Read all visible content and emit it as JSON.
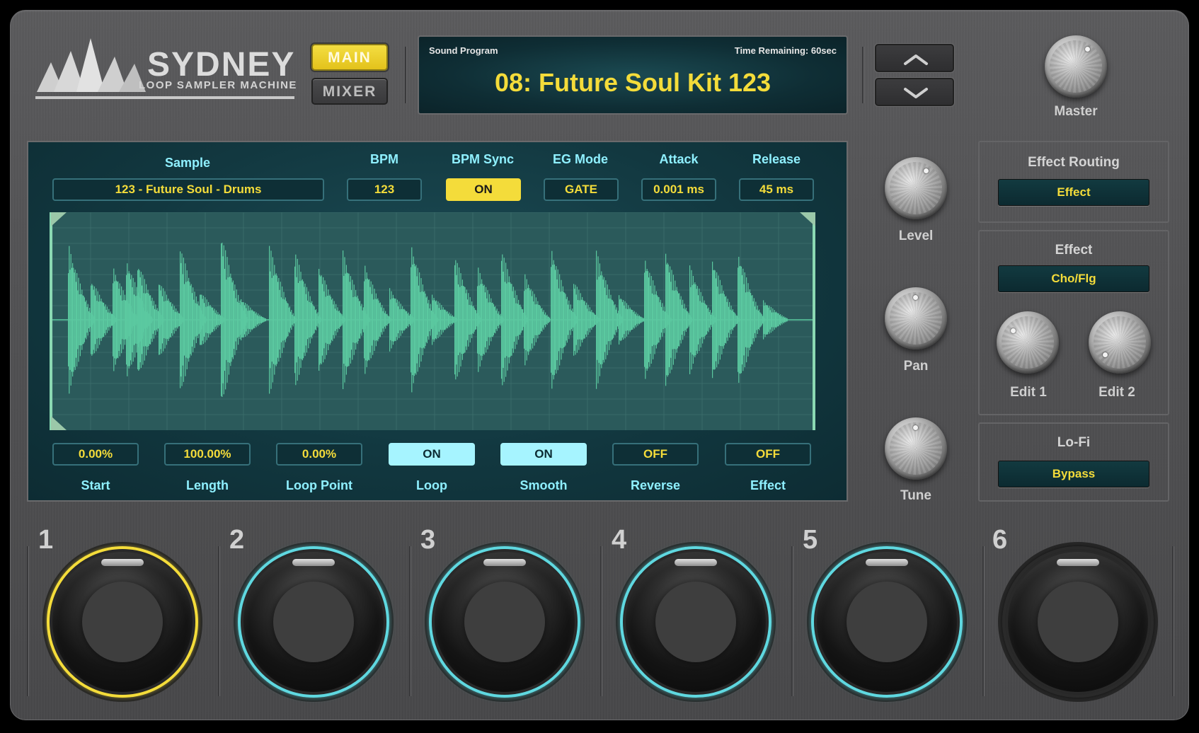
{
  "logo": {
    "title": "SYDNEY",
    "subtitle": "LOOP SAMPLER MACHINE"
  },
  "modes": {
    "main": "MAIN",
    "mixer": "MIXER",
    "active": "MAIN"
  },
  "program": {
    "label": "Sound Program",
    "time_remaining": "Time Remaining: 60sec",
    "name": "08: Future Soul Kit 123"
  },
  "master": {
    "label": "Master"
  },
  "params_top": [
    {
      "label": "Sample",
      "value": "123 - Future Soul - Drums",
      "state": "normal"
    },
    {
      "label": "BPM",
      "value": "123",
      "state": "normal"
    },
    {
      "label": "BPM Sync",
      "value": "ON",
      "state": "on-yellow"
    },
    {
      "label": "EG Mode",
      "value": "GATE",
      "state": "normal"
    },
    {
      "label": "Attack",
      "value": "0.001 ms",
      "state": "normal"
    },
    {
      "label": "Release",
      "value": "45 ms",
      "state": "normal"
    }
  ],
  "params_bottom": [
    {
      "label": "Start",
      "value": "0.00%",
      "state": "normal"
    },
    {
      "label": "Length",
      "value": "100.00%",
      "state": "normal"
    },
    {
      "label": "Loop Point",
      "value": "0.00%",
      "state": "normal"
    },
    {
      "label": "Loop",
      "value": "ON",
      "state": "on-cyan"
    },
    {
      "label": "Smooth",
      "value": "ON",
      "state": "on-cyan"
    },
    {
      "label": "Reverse",
      "value": "OFF",
      "state": "normal"
    },
    {
      "label": "Effect",
      "value": "OFF",
      "state": "normal"
    }
  ],
  "knobs": {
    "level": "Level",
    "pan": "Pan",
    "tune": "Tune"
  },
  "effect_routing": {
    "title": "Effect Routing",
    "value": "Effect"
  },
  "effect": {
    "title": "Effect",
    "value": "Cho/Flg",
    "edit1": "Edit 1",
    "edit2": "Edit 2"
  },
  "lofi": {
    "title": "Lo-Fi",
    "value": "Bypass"
  },
  "pads": [
    {
      "number": "1",
      "ring": "yellow"
    },
    {
      "number": "2",
      "ring": "cyan"
    },
    {
      "number": "3",
      "ring": "cyan"
    },
    {
      "number": "4",
      "ring": "cyan"
    },
    {
      "number": "5",
      "ring": "cyan"
    },
    {
      "number": "6",
      "ring": "dark"
    }
  ],
  "colors": {
    "accent_yellow": "#f4dc3a",
    "accent_cyan": "#5fd8e0",
    "waveform": "#5bc9a0",
    "label_cyan": "#8ff0ff"
  }
}
